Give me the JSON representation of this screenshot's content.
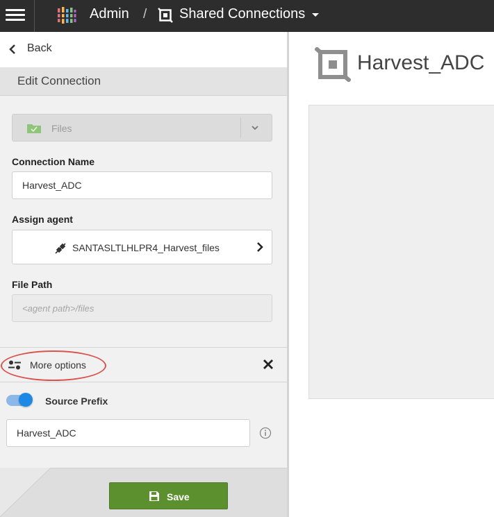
{
  "header": {
    "app_title": "Admin",
    "separator": "/",
    "breadcrumb_label": "Shared Connections",
    "icons": {
      "menu": "hamburger-icon",
      "logo": "app-logo-icon",
      "breadcrumb": "connection-icon",
      "dropdown": "caret-down-icon"
    }
  },
  "panel": {
    "back_label": "Back",
    "section_title": "Edit Connection",
    "connection_type": {
      "value": "Files",
      "icon": "folder-icon"
    },
    "connection_name": {
      "label": "Connection Name",
      "value": "Harvest_ADC"
    },
    "assign_agent": {
      "label": "Assign agent",
      "value": "SANTASLTLHLPR4_Harvest_files",
      "icon": "plug-icon"
    },
    "file_path": {
      "label": "File Path",
      "value": "",
      "placeholder": "<agent path>/files"
    },
    "more_options": {
      "label": "More options",
      "icon": "sliders-icon",
      "highlighted": true
    },
    "source_prefix": {
      "label": "Source Prefix",
      "enabled": true,
      "value": "Harvest_ADC"
    },
    "save_label": "Save"
  },
  "main": {
    "title": "Harvest_ADC",
    "icon": "connection-icon"
  },
  "colors": {
    "topbar": "#2d2d2d",
    "accent_blue": "#1e88e5",
    "save_green": "#5c8f2e",
    "highlight_red": "#d9534f"
  }
}
